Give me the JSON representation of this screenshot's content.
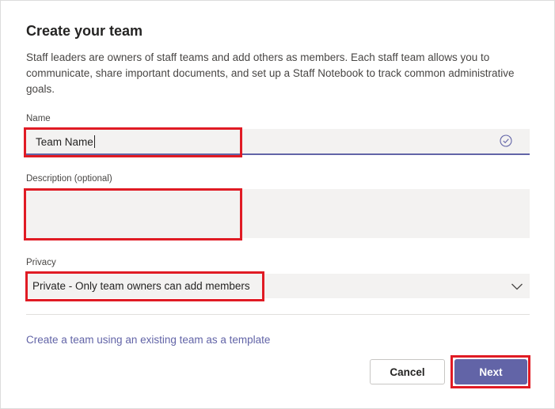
{
  "dialog": {
    "title": "Create your team",
    "description": "Staff leaders are owners of staff teams and add others as members. Each staff team allows you to communicate, share important documents, and set up a Staff Notebook to track common administrative goals."
  },
  "form": {
    "name_label": "Name",
    "name_value": "Team Name",
    "description_label": "Description (optional)",
    "description_value": "",
    "privacy_label": "Privacy",
    "privacy_value": "Private - Only team owners can add members"
  },
  "links": {
    "template_link": "Create a team using an existing team as a template"
  },
  "buttons": {
    "cancel": "Cancel",
    "next": "Next"
  },
  "icons": {
    "name_status": "check-circle-icon",
    "privacy_dropdown": "chevron-down-icon"
  },
  "colors": {
    "accent": "#6264a7",
    "highlight": "#e01b24",
    "field_bg": "#f3f2f1"
  }
}
